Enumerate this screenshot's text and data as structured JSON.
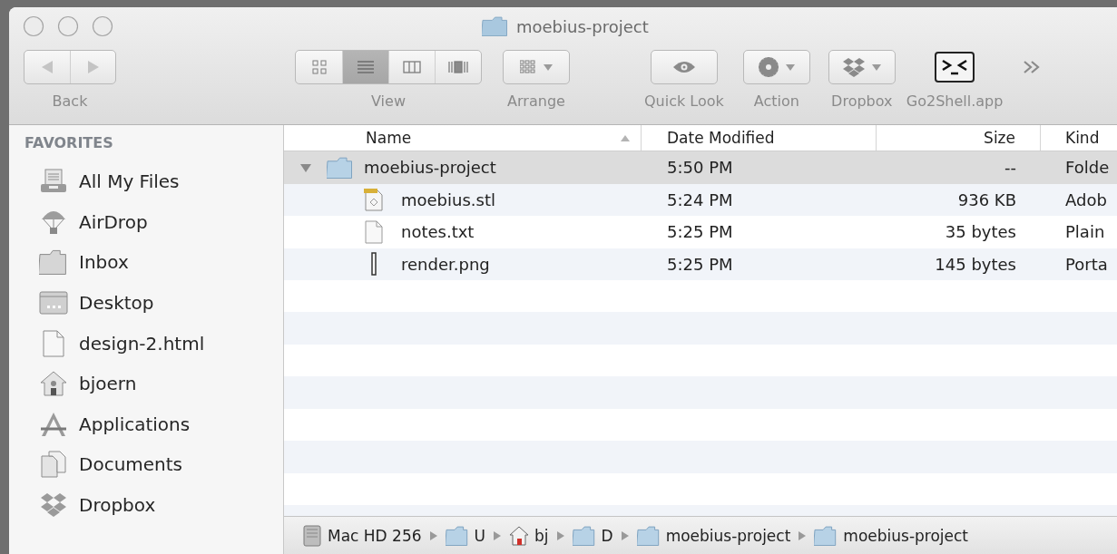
{
  "window": {
    "title": "moebius-project"
  },
  "toolbar": {
    "items": [
      {
        "kind": "navigation",
        "label": "Back"
      },
      {
        "kind": "view",
        "label": "View",
        "segments": [
          {
            "selected": false
          },
          {
            "selected": true
          },
          {
            "selected": false
          },
          {
            "selected": false
          }
        ]
      },
      {
        "kind": "arrange",
        "label": "Arrange"
      },
      {
        "kind": "quicklook",
        "label": "Quick Look"
      },
      {
        "kind": "action",
        "label": "Action"
      },
      {
        "kind": "dropbox",
        "label": "Dropbox"
      },
      {
        "kind": "app",
        "label": "Go2Shell.app"
      },
      {
        "kind": "overflow"
      }
    ]
  },
  "sidebar": {
    "heading": "FAVORITES",
    "items": [
      {
        "label": "All My Files"
      },
      {
        "label": "AirDrop"
      },
      {
        "label": "Inbox"
      },
      {
        "label": "Desktop"
      },
      {
        "label": "design-2.html"
      },
      {
        "label": "bjoern"
      },
      {
        "label": "Applications"
      },
      {
        "label": "Documents"
      },
      {
        "label": "Dropbox"
      }
    ]
  },
  "table": {
    "columns": [
      {
        "label": "Name",
        "sorted": true
      },
      {
        "label": "Date Modified",
        "sorted": false
      },
      {
        "label": "Size",
        "sorted": false
      },
      {
        "label": "Kind",
        "sorted": false
      }
    ],
    "rows": [
      {
        "name": "moebius-project",
        "date": "5:50 PM",
        "size": "--",
        "kind": "Folde",
        "expanded": true,
        "selected": true,
        "children": [
          {
            "name": "moebius.stl",
            "date": "5:24 PM",
            "size": "936 KB",
            "kind": "Adob",
            "selected": false
          },
          {
            "name": "notes.txt",
            "date": "5:25 PM",
            "size": "35 bytes",
            "kind": "Plain",
            "selected": false
          },
          {
            "name": "render.png",
            "date": "5:25 PM",
            "size": "145 bytes",
            "kind": "Porta",
            "selected": false
          }
        ]
      }
    ]
  },
  "path_bar": {
    "segments": [
      {
        "label": "Mac HD 256"
      },
      {
        "label": "U"
      },
      {
        "label": "bj"
      },
      {
        "label": "D"
      },
      {
        "label": "moebius-project"
      },
      {
        "label": "moebius-project"
      }
    ]
  }
}
